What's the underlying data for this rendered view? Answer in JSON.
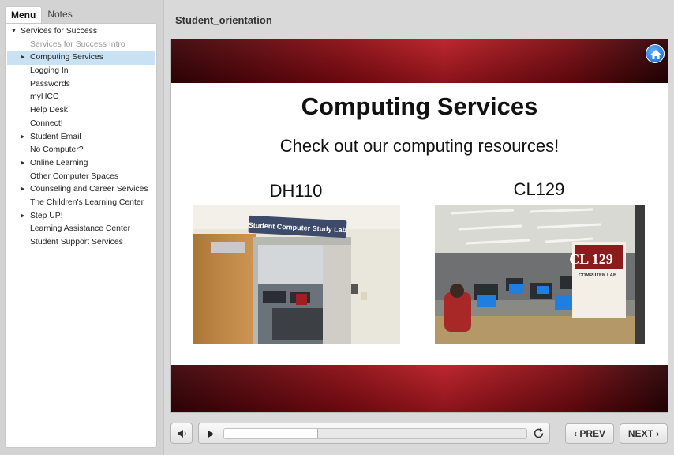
{
  "sidebar": {
    "tabs": [
      {
        "label": "Menu",
        "active": true
      },
      {
        "label": "Notes",
        "active": false
      }
    ],
    "items": [
      {
        "label": "Services for Success",
        "level": 0,
        "expanded": true,
        "caret": "down"
      },
      {
        "label": "Services for Success Intro",
        "level": 1,
        "dim": true
      },
      {
        "label": "Computing Services",
        "level": 1,
        "selected": true,
        "caret": "right"
      },
      {
        "label": "Logging In",
        "level": 1
      },
      {
        "label": "Passwords",
        "level": 1
      },
      {
        "label": "myHCC",
        "level": 1
      },
      {
        "label": "Help Desk",
        "level": 1
      },
      {
        "label": "Connect!",
        "level": 1
      },
      {
        "label": "Student Email",
        "level": 1,
        "caret": "right"
      },
      {
        "label": "No Computer?",
        "level": 1
      },
      {
        "label": "Online Learning",
        "level": 1,
        "caret": "right"
      },
      {
        "label": "Other Computer Spaces",
        "level": 1
      },
      {
        "label": "Counseling and Career Services",
        "level": 1,
        "caret": "right"
      },
      {
        "label": "The Children's Learning Center",
        "level": 1
      },
      {
        "label": "Step UP!",
        "level": 1,
        "caret": "right"
      },
      {
        "label": "Learning Assistance Center",
        "level": 1
      },
      {
        "label": "Student Support Services",
        "level": 1
      }
    ]
  },
  "header": {
    "title": "Student_orientation"
  },
  "slide": {
    "heading": "Computing Services",
    "subheading": "Check out our computing resources!",
    "photos": [
      {
        "label": "DH110",
        "sign_text": "Student Computer Study Lab"
      },
      {
        "label": "CL129",
        "sign_text": "CL 129",
        "sign_sub": "COMPUTER LAB"
      }
    ],
    "home_icon": "home-icon",
    "band_color": "#9e1119"
  },
  "player": {
    "volume_icon": "speaker-icon",
    "play_icon": "play-icon",
    "replay_icon": "replay-icon",
    "progress": 0.31,
    "prev_label": "PREV",
    "next_label": "NEXT"
  }
}
